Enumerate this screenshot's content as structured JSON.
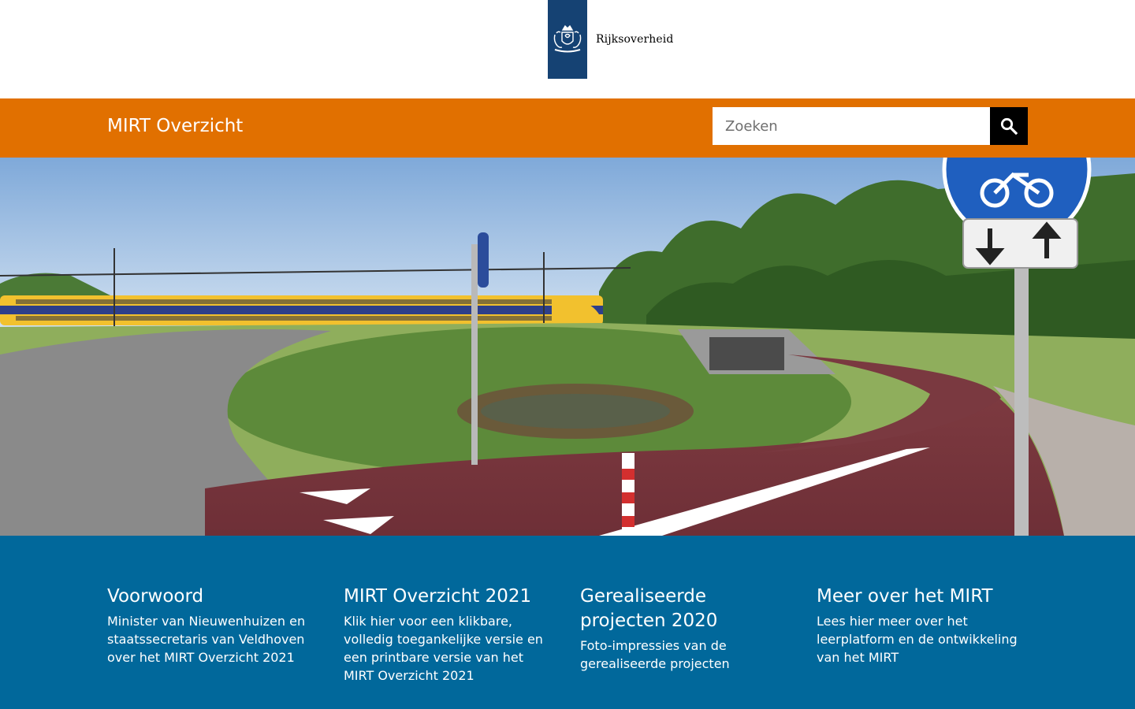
{
  "header": {
    "logo_text": "Rijksoverheid",
    "logo_icon": "royal-coat-of-arms-icon",
    "brand_color": "#154273"
  },
  "topbar": {
    "site_title": "MIRT Overzicht",
    "accent_color": "#e17000",
    "search_placeholder": "Zoeken",
    "search_value": "",
    "search_icon": "search-icon"
  },
  "hero": {
    "description": "cycle-path-photo"
  },
  "tiles": {
    "background_color": "#01689b",
    "items": [
      {
        "title": "Voorwoord",
        "text": "Minister van Nieuwenhuizen en staatssecretaris van Veldhoven over het MIRT Overzicht 2021"
      },
      {
        "title": "MIRT Overzicht 2021",
        "text": "Klik hier voor een klikbare, volledig toegankelijke versie en een printbare versie van het MIRT Overzicht 2021"
      },
      {
        "title": "Gerealiseerde projecten 2020",
        "text": "Foto-impressies van de gerealiseerde projecten"
      },
      {
        "title": "Meer over het MIRT",
        "text": "Lees hier meer over het leerplatform en de ontwikkeling van het MIRT"
      }
    ]
  }
}
